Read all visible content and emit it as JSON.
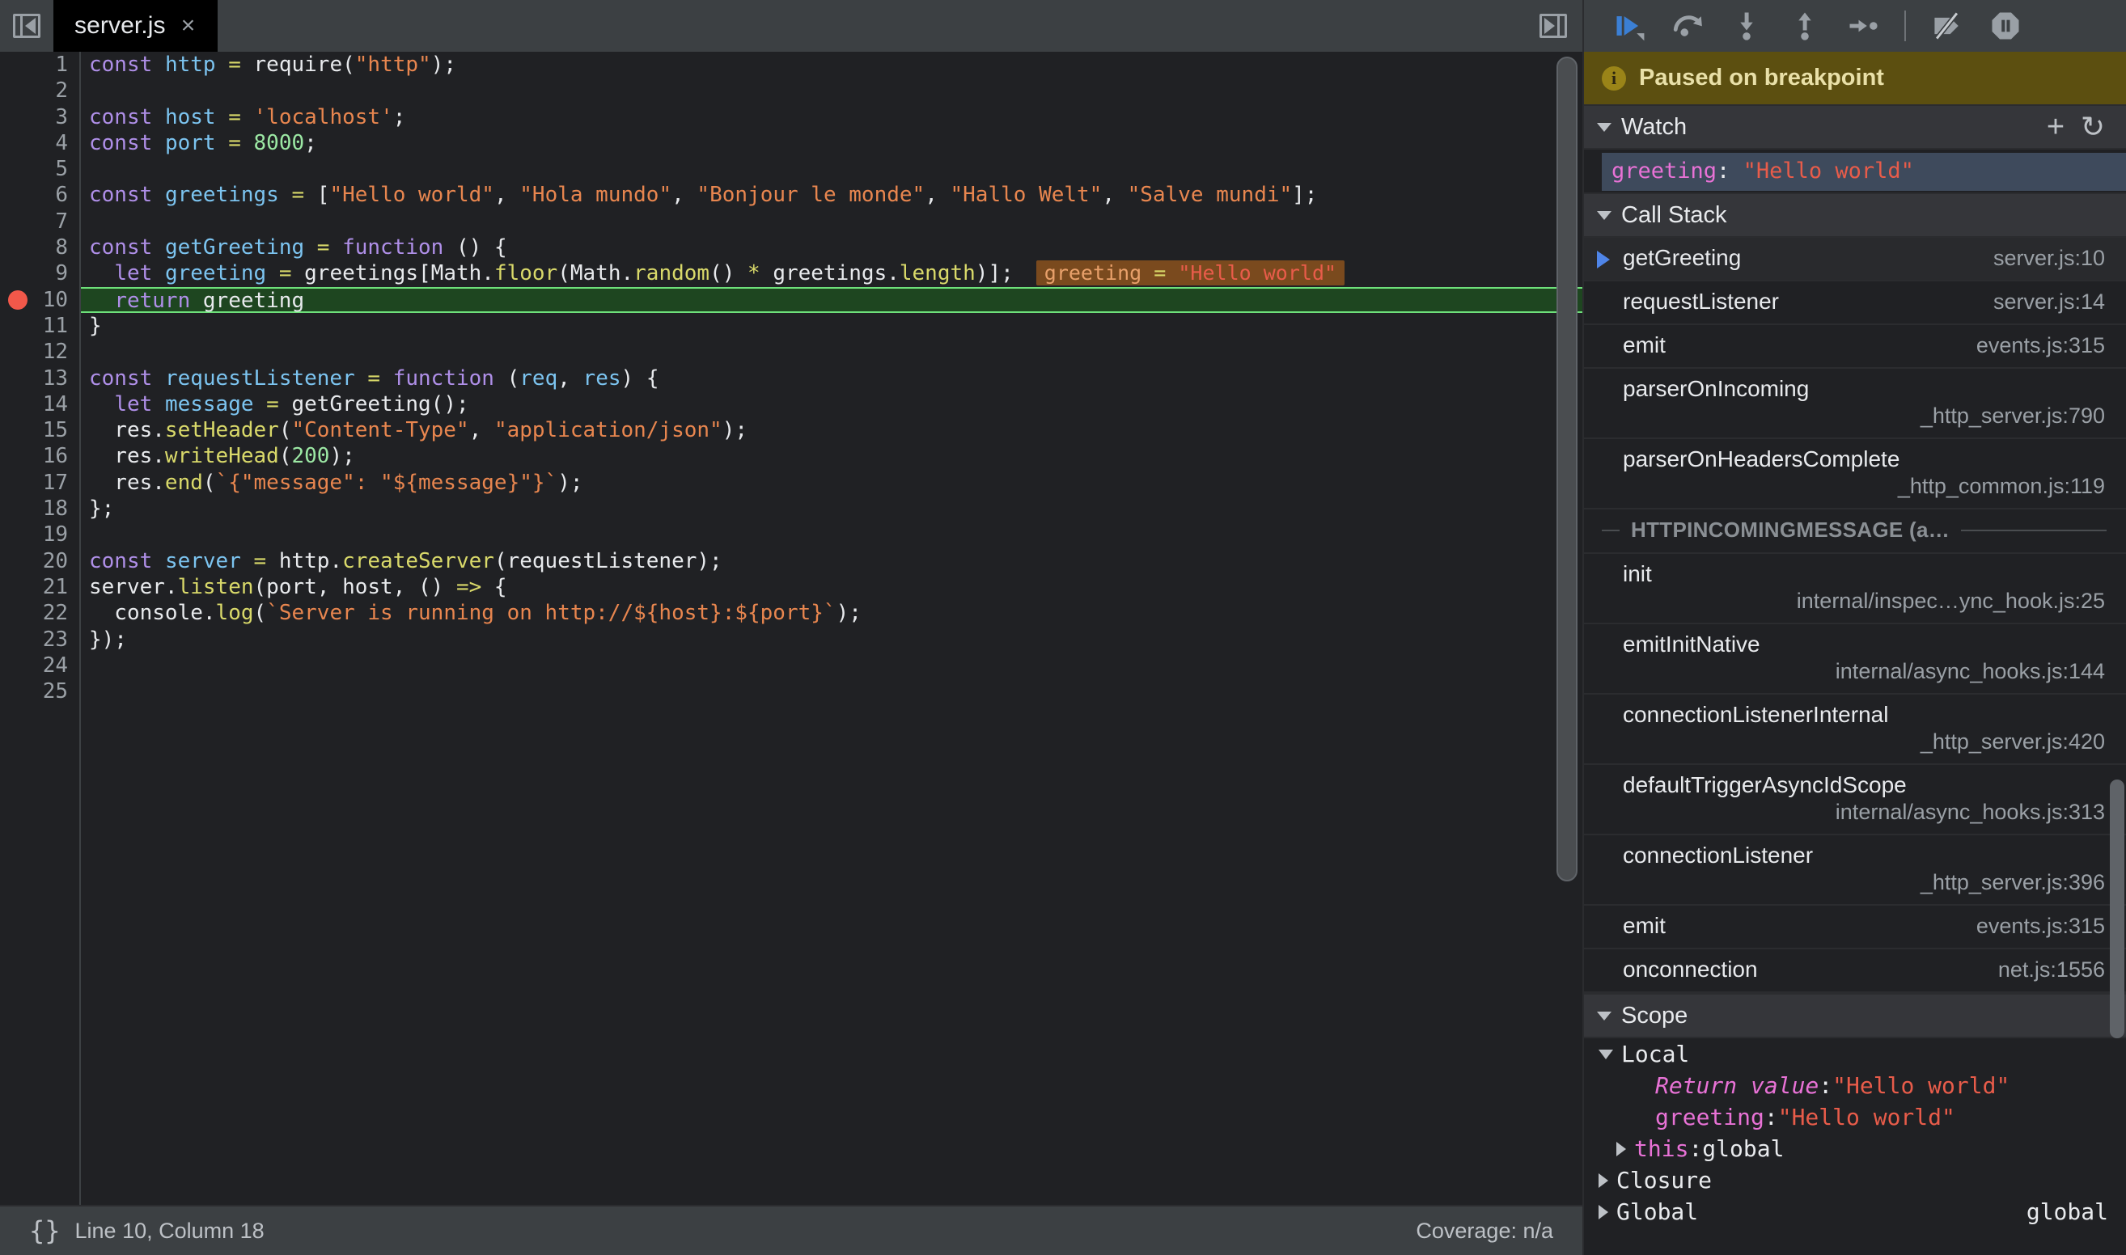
{
  "topbar": {
    "sidebar_toggle_icon": "panel-collapse-left-icon",
    "right_toggle_icon": "panel-collapse-right-icon",
    "tab": {
      "label": "server.js",
      "close_glyph": "×"
    },
    "debugger_buttons": [
      {
        "name": "resume-script-execution",
        "icon": "resume-icon"
      },
      {
        "name": "step-over-next-function-call",
        "icon": "step-over-icon"
      },
      {
        "name": "step-into-next-function-call",
        "icon": "step-into-icon"
      },
      {
        "name": "step-out-of-current-function",
        "icon": "step-out-icon"
      },
      {
        "name": "step",
        "icon": "step-icon"
      },
      {
        "name": "deactivate-breakpoints",
        "icon": "deactivate-breakpoints-icon"
      },
      {
        "name": "pause-on-exceptions",
        "icon": "pause-on-exceptions-icon"
      }
    ]
  },
  "editor": {
    "first_line": 1,
    "total_lines": 25,
    "breakpoint_line": 10,
    "execution_line": 10,
    "inline_value": {
      "name": "greeting",
      "op": "=",
      "value": "\"Hello world\""
    }
  },
  "statusbar": {
    "pretty_print_icon": "{}",
    "position": "Line 10, Column 18",
    "coverage": "Coverage: n/a"
  },
  "debug": {
    "paused_banner": {
      "text": "Paused on breakpoint",
      "icon": "info-icon",
      "badge": "i"
    },
    "watch": {
      "title": "Watch",
      "add_icon": "+",
      "refresh_icon": "↻",
      "items": [
        {
          "name": "greeting",
          "sep": ": ",
          "value": "\"Hello world\""
        }
      ]
    },
    "call_stack": {
      "title": "Call Stack",
      "frames": [
        {
          "name": "getGreeting",
          "location": "server.js:10",
          "selected": true,
          "wrap": false
        },
        {
          "name": "requestListener",
          "location": "server.js:14",
          "selected": false,
          "wrap": false
        },
        {
          "name": "emit",
          "location": "events.js:315",
          "selected": false,
          "wrap": false
        },
        {
          "name": "parserOnIncoming",
          "location": "_http_server.js:790",
          "selected": false,
          "wrap": true
        },
        {
          "name": "parserOnHeadersComplete",
          "location": "_http_common.js:119",
          "selected": false,
          "wrap": true
        },
        {
          "type": "async",
          "name": "HTTPINCOMINGMESSAGE (a…"
        },
        {
          "name": "init",
          "location": "internal/inspec…ync_hook.js:25",
          "selected": false,
          "wrap": true
        },
        {
          "name": "emitInitNative",
          "location": "internal/async_hooks.js:144",
          "selected": false,
          "wrap": true
        },
        {
          "name": "connectionListenerInternal",
          "location": "_http_server.js:420",
          "selected": false,
          "wrap": true
        },
        {
          "name": "defaultTriggerAsyncIdScope",
          "location": "internal/async_hooks.js:313",
          "selected": false,
          "wrap": true
        },
        {
          "name": "connectionListener",
          "location": "_http_server.js:396",
          "selected": false,
          "wrap": true
        },
        {
          "name": "emit",
          "location": "events.js:315",
          "selected": false,
          "wrap": false
        },
        {
          "name": "onconnection",
          "location": "net.js:1556",
          "selected": false,
          "wrap": false
        }
      ]
    },
    "scope": {
      "title": "Scope",
      "groups": [
        {
          "label": "Local",
          "expanded": true,
          "indent": 0
        },
        {
          "label": "Return value",
          "sep": ": ",
          "value": "\"Hello world\"",
          "italic": true,
          "indent": 2,
          "kind": "prop"
        },
        {
          "label": "greeting",
          "sep": ": ",
          "value": "\"Hello world\"",
          "italic": false,
          "indent": 2,
          "kind": "prop"
        },
        {
          "label": "this",
          "sep": ": ",
          "value": "global",
          "plain": true,
          "indent": 1,
          "kind": "obj"
        },
        {
          "label": "Closure",
          "expanded": false,
          "indent": 0
        },
        {
          "label": "Global",
          "expanded": false,
          "indent": 0,
          "right": "global"
        }
      ]
    }
  },
  "code": [
    {
      "n": 1,
      "tokens": [
        [
          "kw",
          "const"
        ],
        [
          "pl",
          " "
        ],
        [
          "id",
          "http"
        ],
        [
          "pl",
          " "
        ],
        [
          "op",
          "="
        ],
        [
          "pl",
          " require("
        ],
        [
          "str",
          "\"http\""
        ],
        [
          "pl",
          ");"
        ]
      ]
    },
    {
      "n": 2,
      "tokens": []
    },
    {
      "n": 3,
      "tokens": [
        [
          "kw",
          "const"
        ],
        [
          "pl",
          " "
        ],
        [
          "id",
          "host"
        ],
        [
          "pl",
          " "
        ],
        [
          "op",
          "="
        ],
        [
          "pl",
          " "
        ],
        [
          "str",
          "'localhost'"
        ],
        [
          "pl",
          ";"
        ]
      ]
    },
    {
      "n": 4,
      "tokens": [
        [
          "kw",
          "const"
        ],
        [
          "pl",
          " "
        ],
        [
          "id",
          "port"
        ],
        [
          "pl",
          " "
        ],
        [
          "op",
          "="
        ],
        [
          "pl",
          " "
        ],
        [
          "num",
          "8000"
        ],
        [
          "pl",
          ";"
        ]
      ]
    },
    {
      "n": 5,
      "tokens": []
    },
    {
      "n": 6,
      "tokens": [
        [
          "kw",
          "const"
        ],
        [
          "pl",
          " "
        ],
        [
          "id",
          "greetings"
        ],
        [
          "pl",
          " "
        ],
        [
          "op",
          "="
        ],
        [
          "pl",
          " ["
        ],
        [
          "str",
          "\"Hello world\""
        ],
        [
          "pl",
          ", "
        ],
        [
          "str",
          "\"Hola mundo\""
        ],
        [
          "pl",
          ", "
        ],
        [
          "str",
          "\"Bonjour le monde\""
        ],
        [
          "pl",
          ", "
        ],
        [
          "str",
          "\"Hallo Welt\""
        ],
        [
          "pl",
          ", "
        ],
        [
          "str",
          "\"Salve mundi\""
        ],
        [
          "pl",
          "];"
        ]
      ]
    },
    {
      "n": 7,
      "tokens": []
    },
    {
      "n": 8,
      "tokens": [
        [
          "kw",
          "const"
        ],
        [
          "pl",
          " "
        ],
        [
          "id",
          "getGreeting"
        ],
        [
          "pl",
          " "
        ],
        [
          "op",
          "="
        ],
        [
          "pl",
          " "
        ],
        [
          "kw",
          "function"
        ],
        [
          "pl",
          " () {"
        ]
      ]
    },
    {
      "n": 9,
      "tokens": [
        [
          "pl",
          "  "
        ],
        [
          "kw",
          "let"
        ],
        [
          "pl",
          " "
        ],
        [
          "id",
          "greeting"
        ],
        [
          "pl",
          " "
        ],
        [
          "op",
          "="
        ],
        [
          "pl",
          " greetings[Math."
        ],
        [
          "fn",
          "floor"
        ],
        [
          "pl",
          "(Math."
        ],
        [
          "fn",
          "random"
        ],
        [
          "pl",
          "() "
        ],
        [
          "op",
          "*"
        ],
        [
          "pl",
          " greetings."
        ],
        [
          "fn",
          "length"
        ],
        [
          "pl",
          ")];"
        ]
      ],
      "inline": true
    },
    {
      "n": 10,
      "tokens": [
        [
          "pl",
          "  "
        ],
        [
          "kw",
          "return"
        ],
        [
          "pl",
          " greeting"
        ]
      ],
      "exec": true,
      "bp": true
    },
    {
      "n": 11,
      "tokens": [
        [
          "pl",
          "}"
        ]
      ]
    },
    {
      "n": 12,
      "tokens": []
    },
    {
      "n": 13,
      "tokens": [
        [
          "kw",
          "const"
        ],
        [
          "pl",
          " "
        ],
        [
          "id",
          "requestListener"
        ],
        [
          "pl",
          " "
        ],
        [
          "op",
          "="
        ],
        [
          "pl",
          " "
        ],
        [
          "kw",
          "function"
        ],
        [
          "pl",
          " ("
        ],
        [
          "prm",
          "req"
        ],
        [
          "pl",
          ", "
        ],
        [
          "prm",
          "res"
        ],
        [
          "pl",
          ") {"
        ]
      ]
    },
    {
      "n": 14,
      "tokens": [
        [
          "pl",
          "  "
        ],
        [
          "kw",
          "let"
        ],
        [
          "pl",
          " "
        ],
        [
          "id",
          "message"
        ],
        [
          "pl",
          " "
        ],
        [
          "op",
          "="
        ],
        [
          "pl",
          " getGreeting();"
        ]
      ]
    },
    {
      "n": 15,
      "tokens": [
        [
          "pl",
          "  res."
        ],
        [
          "fn",
          "setHeader"
        ],
        [
          "pl",
          "("
        ],
        [
          "str",
          "\"Content-Type\""
        ],
        [
          "pl",
          ", "
        ],
        [
          "str",
          "\"application/json\""
        ],
        [
          "pl",
          ");"
        ]
      ]
    },
    {
      "n": 16,
      "tokens": [
        [
          "pl",
          "  res."
        ],
        [
          "fn",
          "writeHead"
        ],
        [
          "pl",
          "("
        ],
        [
          "num",
          "200"
        ],
        [
          "pl",
          ");"
        ]
      ]
    },
    {
      "n": 17,
      "tokens": [
        [
          "pl",
          "  res."
        ],
        [
          "fn",
          "end"
        ],
        [
          "pl",
          "("
        ],
        [
          "str",
          "`{\"message\": \"${message}\"}`"
        ],
        [
          "pl",
          ");"
        ]
      ]
    },
    {
      "n": 18,
      "tokens": [
        [
          "pl",
          "};"
        ]
      ]
    },
    {
      "n": 19,
      "tokens": []
    },
    {
      "n": 20,
      "tokens": [
        [
          "kw",
          "const"
        ],
        [
          "pl",
          " "
        ],
        [
          "id",
          "server"
        ],
        [
          "pl",
          " "
        ],
        [
          "op",
          "="
        ],
        [
          "pl",
          " http."
        ],
        [
          "fn",
          "createServer"
        ],
        [
          "pl",
          "(requestListener);"
        ]
      ]
    },
    {
      "n": 21,
      "tokens": [
        [
          "pl",
          "server."
        ],
        [
          "fn",
          "listen"
        ],
        [
          "pl",
          "(port, host, () "
        ],
        [
          "op",
          "=>"
        ],
        [
          "pl",
          " {"
        ]
      ]
    },
    {
      "n": 22,
      "tokens": [
        [
          "pl",
          "  console."
        ],
        [
          "fn",
          "log"
        ],
        [
          "pl",
          "("
        ],
        [
          "str",
          "`Server is running on http://${host}:${port}`"
        ],
        [
          "pl",
          ");"
        ]
      ]
    },
    {
      "n": 23,
      "tokens": [
        [
          "pl",
          "});"
        ]
      ]
    },
    {
      "n": 24,
      "tokens": []
    },
    {
      "n": 25,
      "tokens": []
    }
  ],
  "colors": {
    "editor_bg": "#202124",
    "chrome_bg": "#3c4043",
    "exec_line_bg": "#1e4620",
    "exec_line_border": "#6ee07a",
    "breakpoint": "#f2584a",
    "paused_banner_bg": "#5c4f10",
    "accent_blue": "#4f85e8",
    "inline_value_bg": "#7a4a1e"
  }
}
